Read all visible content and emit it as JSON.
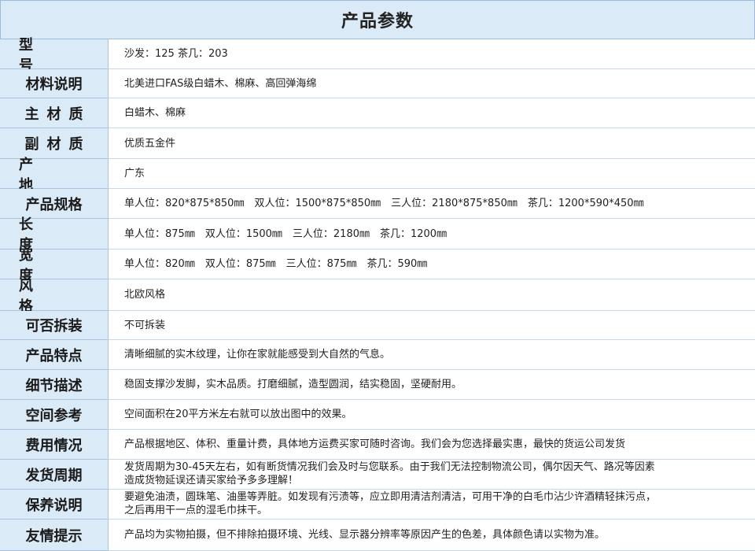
{
  "title": "产品参数",
  "rows": [
    {
      "label": "型　号",
      "value": "沙发：125 茶几：203"
    },
    {
      "label": "材料说明",
      "value": "北美进口FAS级白蜡木、棉麻、高回弹海绵"
    },
    {
      "label": "主材质",
      "value": "白蜡木、棉麻"
    },
    {
      "label": "副材质",
      "value": "优质五金件"
    },
    {
      "label": "产　地",
      "value": "广东"
    },
    {
      "label": "产品规格",
      "value": "单人位：820*875*850㎜　双人位：1500*875*850㎜　三人位：2180*875*850㎜　茶几：1200*590*450㎜"
    },
    {
      "label": "长　度",
      "value": "单人位：875㎜　双人位：1500㎜　三人位：2180㎜　茶几：1200㎜"
    },
    {
      "label": "宽　度",
      "value": "单人位：820㎜　双人位：875㎜　三人位：875㎜　茶几：590㎜"
    },
    {
      "label": "风　格",
      "value": "北欧风格"
    },
    {
      "label": "可否拆装",
      "value": "不可拆装"
    },
    {
      "label": "产品特点",
      "value": "清晰细腻的实木纹理，让你在家就能感受到大自然的气息。"
    },
    {
      "label": "细节描述",
      "value": "稳固支撑沙发脚，实木品质。打磨细腻，造型圆润，结实稳固，坚硬耐用。"
    },
    {
      "label": "空间参考",
      "value": "空间面积在20平方米左右就可以放出图中的效果。"
    },
    {
      "label": "费用情况",
      "value": "产品根据地区、体积、重量计费，具体地方运费买家可随时咨询。我们会为您选择最实惠，最快的货运公司发货"
    },
    {
      "label": "发货周期",
      "value": "发货周期为30-45天左右，如有断货情况我们会及时与您联系。由于我们无法控制物流公司，偶尔因天气、路况等因素\n造成货物延误还请买家给予多多理解！"
    },
    {
      "label": "保养说明",
      "value": "要避免油渍，圆珠笔、油墨等弄脏。如发现有污渍等，应立即用清洁剂清洁，可用干净的白毛巾沾少许酒精轻抹污点，\n之后再用干一点的湿毛巾抹干。"
    },
    {
      "label": "友情提示",
      "value": "产品均为实物拍摄，但不排除拍摄环境、光线、显示器分辨率等原因产生的色差，具体颜色请以实物为准。"
    }
  ]
}
